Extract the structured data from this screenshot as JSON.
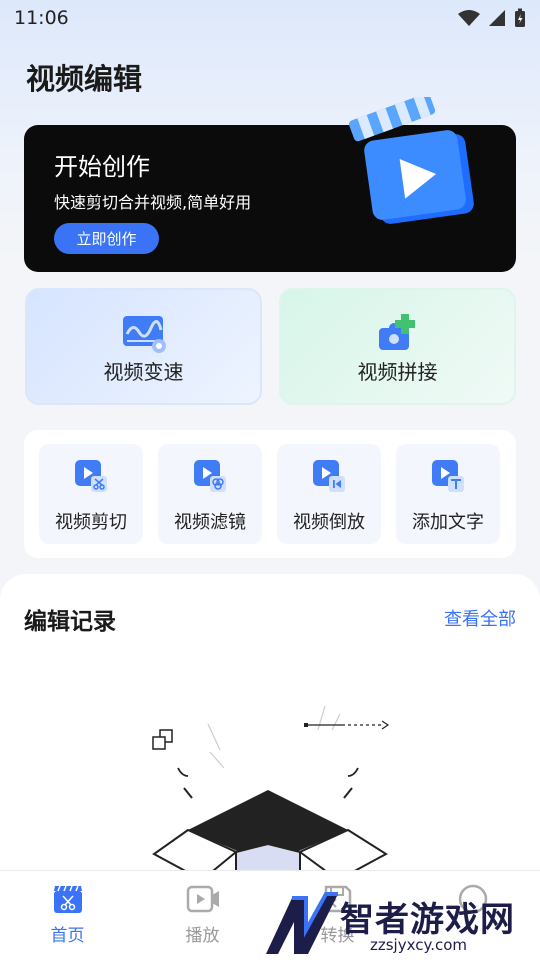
{
  "status_bar": {
    "time": "11:06",
    "icons": [
      "wifi-icon",
      "signal-icon",
      "battery-icon"
    ]
  },
  "page_title": "视频编辑",
  "banner": {
    "title": "开始创作",
    "subtitle": "快速剪切合并视频,简单好用",
    "button": "立即创作"
  },
  "features": [
    {
      "label": "视频变速",
      "icon": "speed-chart-icon"
    },
    {
      "label": "视频拼接",
      "icon": "puzzle-icon"
    }
  ],
  "tools": [
    {
      "label": "视频剪切",
      "icon": "video-scissors-icon"
    },
    {
      "label": "视频滤镜",
      "icon": "video-filter-icon"
    },
    {
      "label": "视频倒放",
      "icon": "video-reverse-icon"
    },
    {
      "label": "添加文字",
      "icon": "video-text-icon"
    }
  ],
  "records": {
    "title": "编辑记录",
    "view_all": "查看全部"
  },
  "tabs": [
    {
      "label": "首页",
      "icon": "clapper-scissors-icon",
      "active": true
    },
    {
      "label": "播放",
      "icon": "video-camera-icon",
      "active": false
    },
    {
      "label": "转换",
      "icon": "save-icon",
      "active": false
    },
    {
      "label": "",
      "icon": "profile-icon",
      "active": false
    }
  ],
  "watermark": {
    "name": "智者游戏网",
    "url": "zzsjyxcy.com"
  },
  "colors": {
    "accent": "#3b73f6",
    "banner_bg": "#0b0b0b",
    "text": "#222222"
  }
}
